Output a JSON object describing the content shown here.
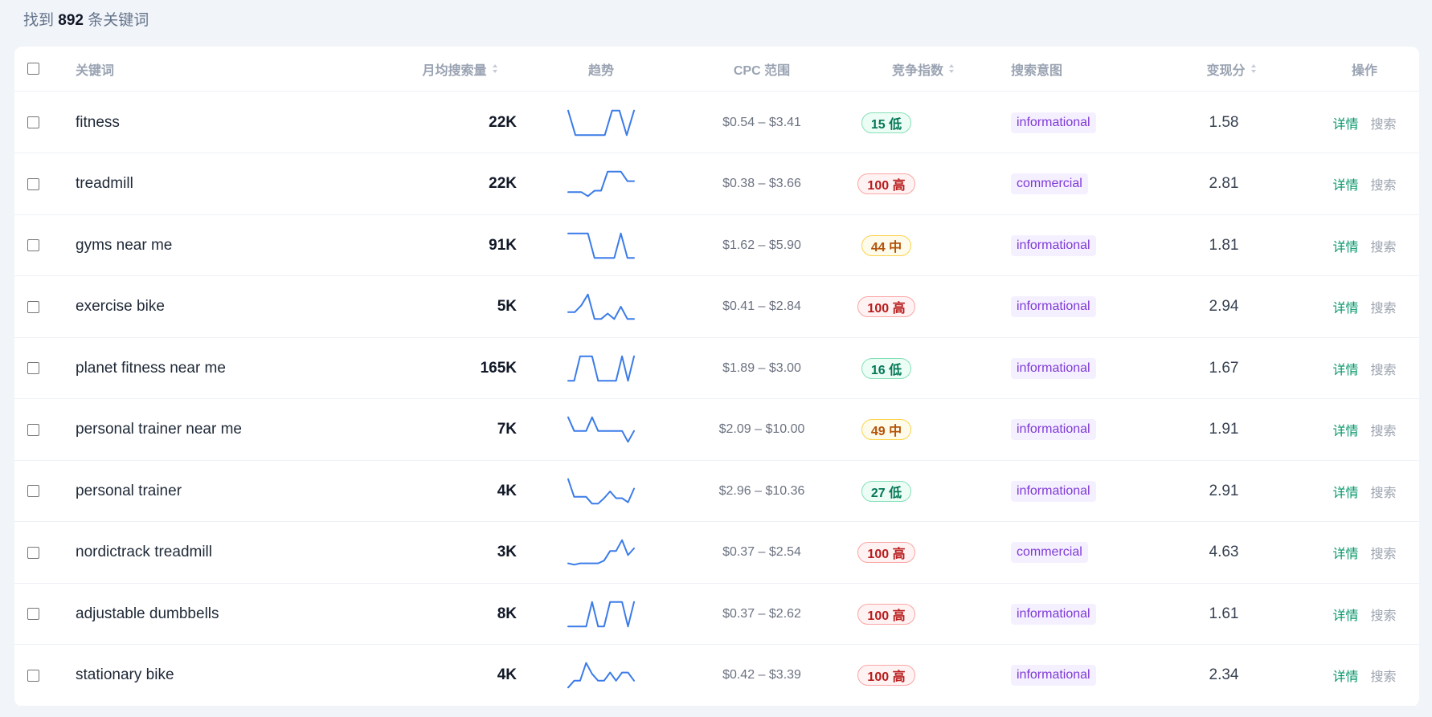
{
  "summary": {
    "prefix": "找到",
    "count": "892",
    "suffix": "条关键词"
  },
  "columns": {
    "keyword": "关键词",
    "volume": "月均搜索量",
    "trend": "趋势",
    "cpc": "CPC 范围",
    "competition": "竞争指数",
    "intent": "搜索意图",
    "score": "变现分",
    "actions": "操作"
  },
  "actions": {
    "detail": "详情",
    "search": "搜索"
  },
  "colors": {
    "trend_line": "#3b7be8",
    "low": "#047857",
    "mid": "#b45309",
    "high": "#b91c1c",
    "intent": "#7e3ad6",
    "detail_link": "#059669"
  },
  "rows": [
    {
      "keyword": "fitness",
      "volume": "22K",
      "trend": [
        0.95,
        0.05,
        0.05,
        0.05,
        0.05,
        0.05,
        0.95,
        0.95,
        0.05,
        0.95
      ],
      "cpc": "$0.54 – $3.41",
      "competition": "15 低",
      "level": "low",
      "intent": "informational",
      "score": "1.58"
    },
    {
      "keyword": "treadmill",
      "volume": "22K",
      "trend": [
        0.2,
        0.2,
        0.2,
        0.05,
        0.25,
        0.25,
        0.95,
        0.95,
        0.95,
        0.6,
        0.6
      ],
      "cpc": "$0.38 – $3.66",
      "competition": "100 高",
      "level": "high",
      "intent": "commercial",
      "score": "2.81"
    },
    {
      "keyword": "gyms near me",
      "volume": "91K",
      "trend": [
        0.95,
        0.95,
        0.95,
        0.95,
        0.05,
        0.05,
        0.05,
        0.05,
        0.95,
        0.05,
        0.05
      ],
      "cpc": "$1.62 – $5.90",
      "competition": "44 中",
      "level": "mid",
      "intent": "informational",
      "score": "1.81"
    },
    {
      "keyword": "exercise bike",
      "volume": "5K",
      "trend": [
        0.3,
        0.3,
        0.55,
        0.95,
        0.05,
        0.05,
        0.25,
        0.05,
        0.5,
        0.05,
        0.05
      ],
      "cpc": "$0.41 – $2.84",
      "competition": "100 高",
      "level": "high",
      "intent": "informational",
      "score": "2.94"
    },
    {
      "keyword": "planet fitness near me",
      "volume": "165K",
      "trend": [
        0.05,
        0.05,
        0.95,
        0.95,
        0.95,
        0.05,
        0.05,
        0.05,
        0.05,
        0.95,
        0.05,
        0.95
      ],
      "cpc": "$1.89 – $3.00",
      "competition": "16 低",
      "level": "low",
      "intent": "informational",
      "score": "1.67"
    },
    {
      "keyword": "personal trainer near me",
      "volume": "7K",
      "trend": [
        0.95,
        0.45,
        0.45,
        0.45,
        0.95,
        0.45,
        0.45,
        0.45,
        0.45,
        0.45,
        0.05,
        0.45
      ],
      "cpc": "$2.09 – $10.00",
      "competition": "49 中",
      "level": "mid",
      "intent": "informational",
      "score": "1.91"
    },
    {
      "keyword": "personal trainer",
      "volume": "4K",
      "trend": [
        0.95,
        0.3,
        0.3,
        0.3,
        0.05,
        0.05,
        0.25,
        0.5,
        0.25,
        0.25,
        0.1,
        0.6
      ],
      "cpc": "$2.96 – $10.36",
      "competition": "27 低",
      "level": "low",
      "intent": "informational",
      "score": "2.91"
    },
    {
      "keyword": "nordictrack treadmill",
      "volume": "3K",
      "trend": [
        0.1,
        0.05,
        0.1,
        0.1,
        0.1,
        0.1,
        0.2,
        0.55,
        0.55,
        0.95,
        0.4,
        0.65
      ],
      "cpc": "$0.37 – $2.54",
      "competition": "100 高",
      "level": "high",
      "intent": "commercial",
      "score": "4.63"
    },
    {
      "keyword": "adjustable dumbbells",
      "volume": "8K",
      "trend": [
        0.05,
        0.05,
        0.05,
        0.05,
        0.95,
        0.05,
        0.05,
        0.95,
        0.95,
        0.95,
        0.05,
        0.95
      ],
      "cpc": "$0.37 – $2.62",
      "competition": "100 高",
      "level": "high",
      "intent": "informational",
      "score": "1.61"
    },
    {
      "keyword": "stationary bike",
      "volume": "4K",
      "trend": [
        0.05,
        0.3,
        0.3,
        0.95,
        0.55,
        0.3,
        0.3,
        0.6,
        0.3,
        0.6,
        0.6,
        0.3
      ],
      "cpc": "$0.42 – $3.39",
      "competition": "100 高",
      "level": "high",
      "intent": "informational",
      "score": "2.34"
    }
  ]
}
